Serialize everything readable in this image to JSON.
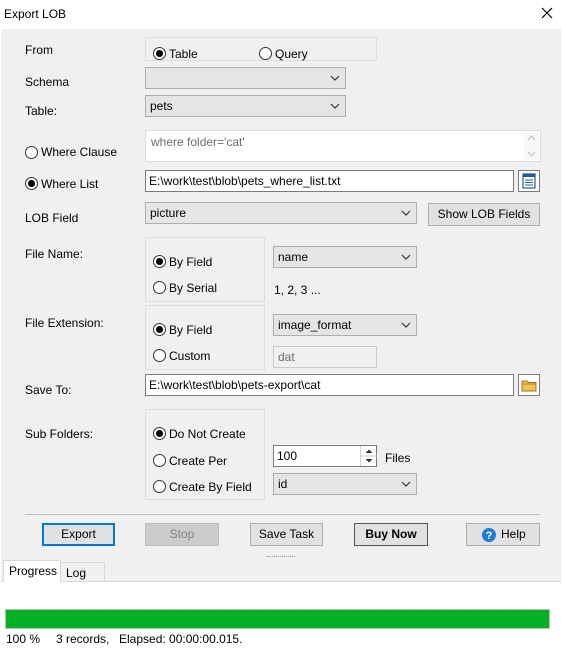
{
  "window": {
    "title": "Export LOB"
  },
  "from": {
    "label": "From",
    "option_table": "Table",
    "option_query": "Query"
  },
  "schema": {
    "label": "Schema",
    "value": ""
  },
  "table": {
    "label": "Table:",
    "value": "pets"
  },
  "where_clause": {
    "label": "Where Clause",
    "placeholder": "where folder='cat'"
  },
  "where_list": {
    "label": "Where List",
    "value": "E:\\work\\test\\blob\\pets_where_list.txt"
  },
  "lob_field": {
    "label": "LOB Field",
    "value": "picture",
    "show_button": "Show LOB Fields"
  },
  "file_name": {
    "label": "File Name:",
    "option_field": "By Field",
    "option_serial": "By Serial",
    "field_value": "name",
    "serial_hint": "1, 2, 3 ..."
  },
  "file_extension": {
    "label": "File Extension:",
    "option_field": "By Field",
    "option_custom": "Custom",
    "field_value": "image_format",
    "custom_value": "dat"
  },
  "save_to": {
    "label": "Save To:",
    "value": "E:\\work\\test\\blob\\pets-export\\cat"
  },
  "sub_folders": {
    "label": "Sub Folders:",
    "option_none": "Do Not Create",
    "option_per": "Create Per",
    "option_by_field": "Create By Field",
    "count": "100",
    "count_unit": "Files",
    "field_value": "id"
  },
  "buttons": {
    "export": "Export",
    "stop": "Stop",
    "save_task": "Save Task",
    "buy_now": "Buy Now",
    "help": "Help"
  },
  "tabs": [
    {
      "label": "Progress"
    },
    {
      "label": "Log"
    }
  ],
  "progress": {
    "fraction": 1.0,
    "percent_text": "100 %",
    "records_text": "3 records,",
    "elapsed_text": "Elapsed: 00:00:00.015."
  },
  "colors": {
    "progress_fill": "#06b025",
    "help_icon": "#1e7ad6"
  }
}
